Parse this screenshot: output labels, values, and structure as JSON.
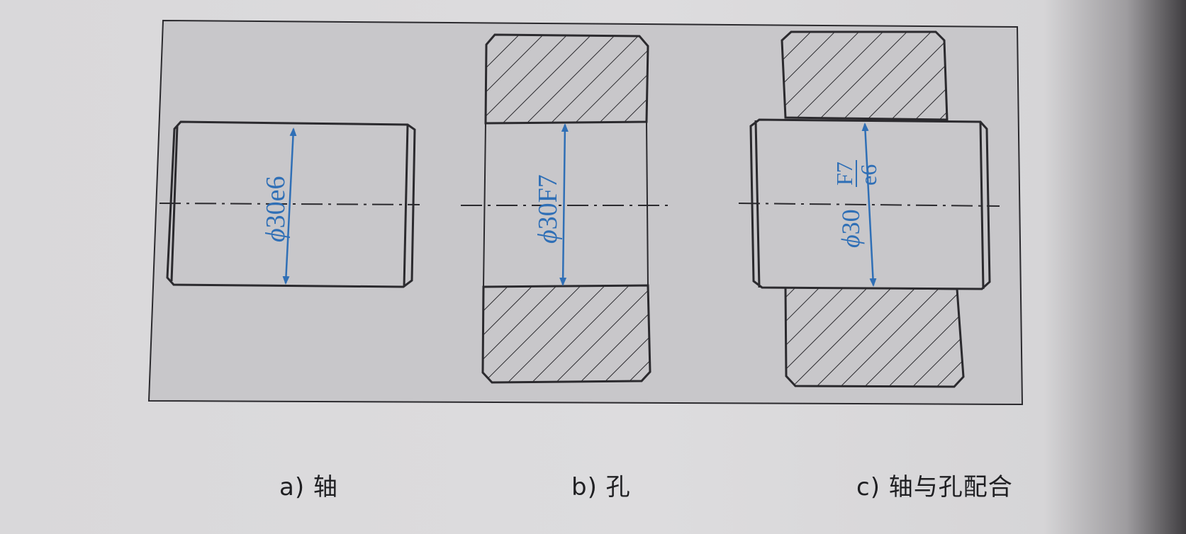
{
  "colors": {
    "panel": "#c8c7ca",
    "stroke": "#2b2a2e",
    "dimension": "#2f6fb6",
    "caption": "#1f1f22"
  },
  "figures": {
    "shaft": {
      "dim_phi": "ϕ",
      "dim_value": "30e6",
      "caption": "a) 轴"
    },
    "hole": {
      "dim_phi": "ϕ",
      "dim_value": "30F7",
      "caption": "b) 孔"
    },
    "fit": {
      "dim_phi": "ϕ",
      "dim_value": "30",
      "dim_upper": "F7",
      "dim_lower": "e6",
      "caption": "c) 轴与孔配合"
    }
  }
}
